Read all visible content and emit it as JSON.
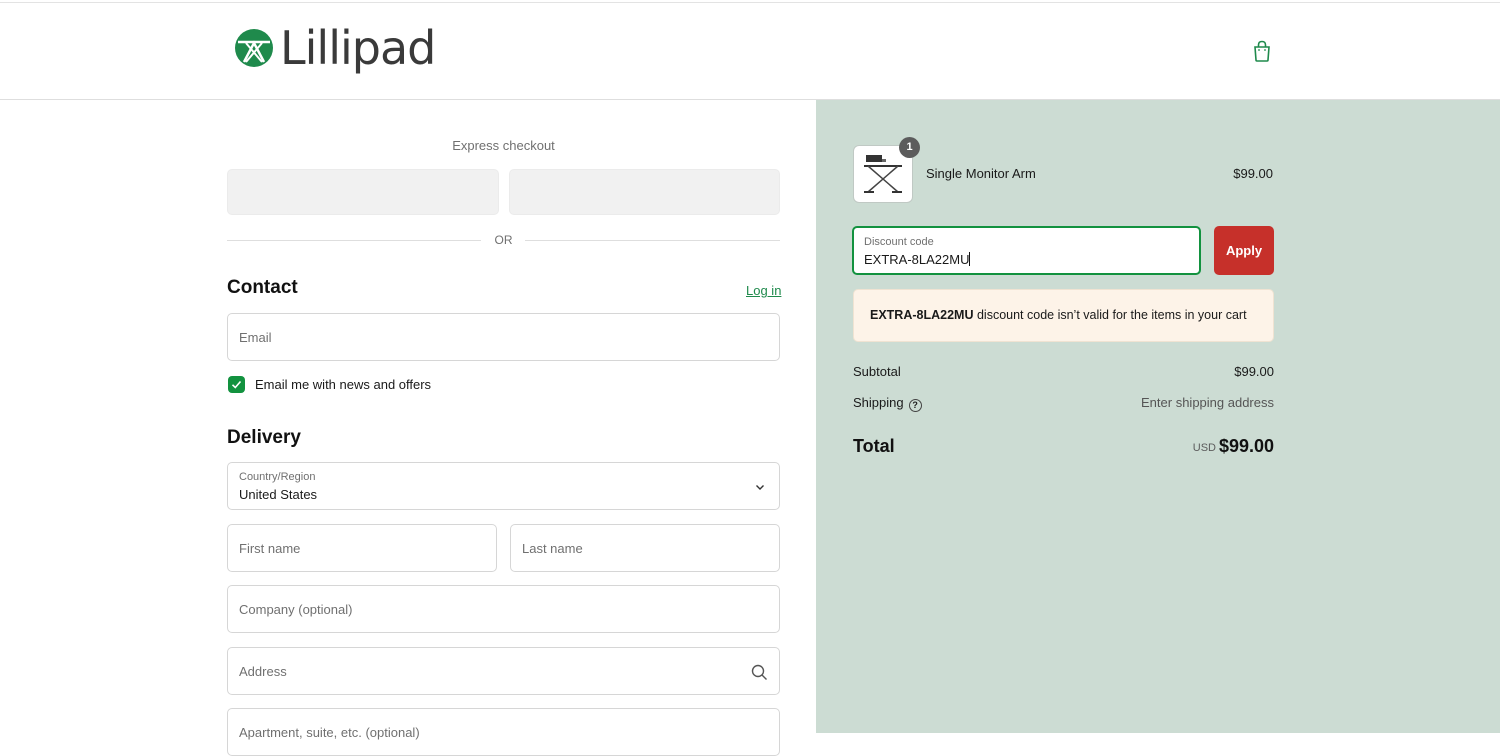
{
  "brand": {
    "name": "Lillipad",
    "accent": "#12923f",
    "logo_color": "#1f8a4c",
    "icon": "shopping-bag-icon"
  },
  "express": {
    "label": "Express checkout",
    "divider": "OR"
  },
  "contact": {
    "title": "Contact",
    "login_label": "Log in",
    "email_placeholder": "Email",
    "newsletter_label": "Email me with news and offers",
    "newsletter_checked": true
  },
  "delivery": {
    "title": "Delivery",
    "country_label": "Country/Region",
    "country_value": "United States",
    "first_name_placeholder": "First name",
    "last_name_placeholder": "Last name",
    "company_placeholder": "Company (optional)",
    "address_placeholder": "Address",
    "apartment_placeholder": "Apartment, suite, etc. (optional)"
  },
  "order": {
    "item": {
      "name": "Single Monitor Arm",
      "price": "$99.00",
      "quantity": "1"
    },
    "discount": {
      "label": "Discount code",
      "value": "EXTRA-8LA22MU",
      "apply_label": "Apply",
      "apply_color": "#c6302a"
    },
    "notice": {
      "code": "EXTRA-8LA22MU",
      "message": " discount code isn’t valid for the items in your cart"
    },
    "subtotal_label": "Subtotal",
    "subtotal_value": "$99.00",
    "shipping_label": "Shipping",
    "shipping_value": "Enter shipping address",
    "total_label": "Total",
    "currency": "USD",
    "total_value": "$99.00"
  }
}
